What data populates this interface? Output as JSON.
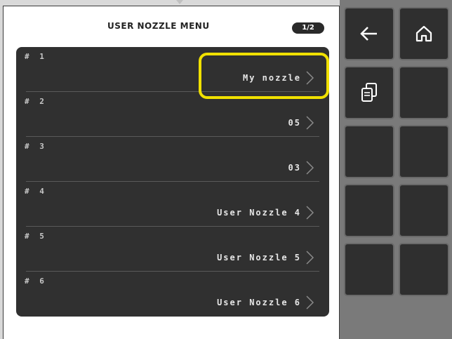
{
  "screen": {
    "title": "USER NOZZLE MENU",
    "page_indicator": "1/2"
  },
  "nozzles": [
    {
      "number": "# 1",
      "value": "My nozzle",
      "selected": true
    },
    {
      "number": "# 2",
      "value": "05",
      "selected": false
    },
    {
      "number": "# 3",
      "value": "03",
      "selected": false
    },
    {
      "number": "# 4",
      "value": "User Nozzle 4",
      "selected": false
    },
    {
      "number": "# 5",
      "value": "User Nozzle 5",
      "selected": false
    },
    {
      "number": "# 6",
      "value": "User Nozzle 6",
      "selected": false
    }
  ],
  "side_panel": {
    "buttons": [
      {
        "icon": "back-arrow-icon"
      },
      {
        "icon": "home-icon"
      },
      {
        "icon": "copy-icon"
      },
      {
        "icon": ""
      },
      {
        "icon": ""
      },
      {
        "icon": ""
      },
      {
        "icon": ""
      },
      {
        "icon": ""
      },
      {
        "icon": ""
      },
      {
        "icon": ""
      }
    ]
  },
  "colors": {
    "highlight": "#f0e000",
    "panel": "#303030",
    "side_bg": "#7a7a7a"
  }
}
